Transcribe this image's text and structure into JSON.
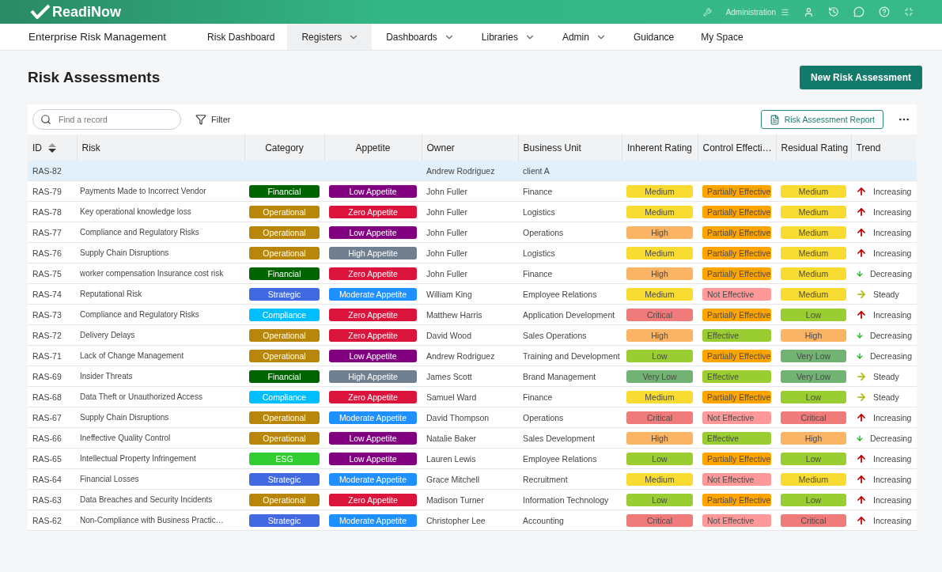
{
  "app": {
    "logo": "ReadiNow",
    "admin_label": "Administration"
  },
  "nav": {
    "title": "Enterprise Risk Management",
    "items": [
      {
        "label": "Risk Dashboard",
        "selected": false,
        "dropdown": false
      },
      {
        "label": "Registers",
        "selected": true,
        "dropdown": true
      },
      {
        "label": "Dashboards",
        "selected": false,
        "dropdown": true
      },
      {
        "label": "Libraries",
        "selected": false,
        "dropdown": true
      },
      {
        "label": "Admin",
        "selected": false,
        "dropdown": true
      },
      {
        "label": "Guidance",
        "selected": false,
        "dropdown": false
      },
      {
        "label": "My Space",
        "selected": false,
        "dropdown": false
      }
    ]
  },
  "page": {
    "title": "Risk Assessments",
    "new_button": "New Risk Assessment"
  },
  "toolbar": {
    "search": {
      "placeholder": "Find a record"
    },
    "filter": "Filter",
    "report_button": "Risk Assessment Report"
  },
  "table": {
    "columns": [
      "ID",
      "Risk",
      "Category",
      "Appetite",
      "Owner",
      "Business Unit",
      "Inherent Rating",
      "Control Effecti…",
      "Residual Rating",
      "Trend"
    ],
    "rows": [
      {
        "id": "RAS-82",
        "risk": "",
        "category": null,
        "appetite": null,
        "owner": "Andrew Rodriguez",
        "unit": "client A",
        "inherent": null,
        "control": null,
        "residual": null,
        "trend": null,
        "selected": true
      },
      {
        "id": "RAS-79",
        "risk": "Payments Made to Incorrect Vendor",
        "category": {
          "label": "Financial",
          "color": "#006400"
        },
        "appetite": {
          "label": "Low Appetite",
          "color": "#800080"
        },
        "owner": "John Fuller",
        "unit": "Finance",
        "inherent": {
          "label": "Medium",
          "color": "#f9dc32"
        },
        "control": {
          "label": "Partially Effective",
          "color": "#ffa500"
        },
        "residual": {
          "label": "Medium",
          "color": "#f9dc32"
        },
        "trend": {
          "label": "Increasing",
          "kind": "up"
        },
        "selected": false
      },
      {
        "id": "RAS-78",
        "risk": "Key operational knowledge loss",
        "category": {
          "label": "Operational",
          "color": "#b8860b"
        },
        "appetite": {
          "label": "Zero Appetite",
          "color": "#dc143c"
        },
        "owner": "John Fuller",
        "unit": "Logistics",
        "inherent": {
          "label": "Medium",
          "color": "#f9dc32"
        },
        "control": {
          "label": "Partially Effective",
          "color": "#ffa500"
        },
        "residual": {
          "label": "Medium",
          "color": "#f9dc32"
        },
        "trend": {
          "label": "Increasing",
          "kind": "up"
        },
        "selected": false
      },
      {
        "id": "RAS-77",
        "risk": "Compliance and Regulatory Risks",
        "category": {
          "label": "Operational",
          "color": "#b8860b"
        },
        "appetite": {
          "label": "Low Appetite",
          "color": "#800080"
        },
        "owner": "John Fuller",
        "unit": "Operations",
        "inherent": {
          "label": "High",
          "color": "#fbb464"
        },
        "control": {
          "label": "Partially Effective",
          "color": "#ffa500"
        },
        "residual": {
          "label": "Medium",
          "color": "#f9dc32"
        },
        "trend": {
          "label": "Increasing",
          "kind": "up"
        },
        "selected": false
      },
      {
        "id": "RAS-76",
        "risk": "Supply Chain Disruptions",
        "category": {
          "label": "Operational",
          "color": "#b8860b"
        },
        "appetite": {
          "label": "High Appetite",
          "color": "#708090"
        },
        "owner": "John Fuller",
        "unit": "Logistics",
        "inherent": {
          "label": "Medium",
          "color": "#f9dc32"
        },
        "control": {
          "label": "Partially Effective",
          "color": "#ffa500"
        },
        "residual": {
          "label": "Medium",
          "color": "#f9dc32"
        },
        "trend": {
          "label": "Increasing",
          "kind": "up"
        },
        "selected": false
      },
      {
        "id": "RAS-75",
        "risk": "worker compensation Insurance cost risk",
        "category": {
          "label": "Financial",
          "color": "#006400"
        },
        "appetite": {
          "label": "Zero Appetite",
          "color": "#dc143c"
        },
        "owner": "John Fuller",
        "unit": "Finance",
        "inherent": {
          "label": "High",
          "color": "#fbb464"
        },
        "control": {
          "label": "Partially Effective",
          "color": "#ffa500"
        },
        "residual": {
          "label": "Medium",
          "color": "#f9dc32"
        },
        "trend": {
          "label": "Decreasing",
          "kind": "down"
        },
        "selected": false
      },
      {
        "id": "RAS-74",
        "risk": "Reputational Risk",
        "category": {
          "label": "Strategic",
          "color": "#4169e1"
        },
        "appetite": {
          "label": "Moderate Appetite",
          "color": "#1e90ff"
        },
        "owner": "William King",
        "unit": "Employee Relations",
        "inherent": {
          "label": "Medium",
          "color": "#f9dc32"
        },
        "control": {
          "label": "Not Effective",
          "color": "#ff9999"
        },
        "residual": {
          "label": "Medium",
          "color": "#f9dc32"
        },
        "trend": {
          "label": "Steady",
          "kind": "steady"
        },
        "selected": false
      },
      {
        "id": "RAS-73",
        "risk": "Compliance and Regulatory Risks",
        "category": {
          "label": "Compliance",
          "color": "#00bfff"
        },
        "appetite": {
          "label": "Zero Appetite",
          "color": "#dc143c"
        },
        "owner": "Matthew Harris",
        "unit": "Application Development",
        "inherent": {
          "label": "Critical",
          "color": "#ef7b7b"
        },
        "control": {
          "label": "Partially Effective",
          "color": "#ffa500"
        },
        "residual": {
          "label": "Low",
          "color": "#9acd32"
        },
        "trend": {
          "label": "Increasing",
          "kind": "up"
        },
        "selected": false
      },
      {
        "id": "RAS-72",
        "risk": "Delivery Delays",
        "category": {
          "label": "Operational",
          "color": "#b8860b"
        },
        "appetite": {
          "label": "Zero Appetite",
          "color": "#dc143c"
        },
        "owner": "David Wood",
        "unit": "Sales Operations",
        "inherent": {
          "label": "High",
          "color": "#fbb464"
        },
        "control": {
          "label": "Effective",
          "color": "#9acd32"
        },
        "residual": {
          "label": "High",
          "color": "#fbb464"
        },
        "trend": {
          "label": "Decreasing",
          "kind": "down"
        },
        "selected": false
      },
      {
        "id": "RAS-71",
        "risk": "Lack of Change Management",
        "category": {
          "label": "Operational",
          "color": "#b8860b"
        },
        "appetite": {
          "label": "Low Appetite",
          "color": "#800080"
        },
        "owner": "Andrew Rodriguez",
        "unit": "Training and Development",
        "inherent": {
          "label": "Low",
          "color": "#9acd32"
        },
        "control": {
          "label": "Partially Effective",
          "color": "#ffa500"
        },
        "residual": {
          "label": "Very Low",
          "color": "#72b272"
        },
        "trend": {
          "label": "Decreasing",
          "kind": "down"
        },
        "selected": false
      },
      {
        "id": "RAS-69",
        "risk": "Insider Threats",
        "category": {
          "label": "Financial",
          "color": "#006400"
        },
        "appetite": {
          "label": "High Appetite",
          "color": "#708090"
        },
        "owner": "James Scott",
        "unit": "Brand Management",
        "inherent": {
          "label": "Very Low",
          "color": "#72b272"
        },
        "control": {
          "label": "Effective",
          "color": "#9acd32"
        },
        "residual": {
          "label": "Very Low",
          "color": "#72b272"
        },
        "trend": {
          "label": "Steady",
          "kind": "steady"
        },
        "selected": false
      },
      {
        "id": "RAS-68",
        "risk": "Data Theft or Unauthorized Access",
        "category": {
          "label": "Compliance",
          "color": "#00bfff"
        },
        "appetite": {
          "label": "Zero Appetite",
          "color": "#dc143c"
        },
        "owner": "Samuel Ward",
        "unit": "Finance",
        "inherent": {
          "label": "Medium",
          "color": "#f9dc32"
        },
        "control": {
          "label": "Partially Effective",
          "color": "#ffa500"
        },
        "residual": {
          "label": "Low",
          "color": "#9acd32"
        },
        "trend": {
          "label": "Steady",
          "kind": "steady"
        },
        "selected": false
      },
      {
        "id": "RAS-67",
        "risk": "Supply Chain Disruptions",
        "category": {
          "label": "Operational",
          "color": "#b8860b"
        },
        "appetite": {
          "label": "Moderate Appetite",
          "color": "#1e90ff"
        },
        "owner": "David Thompson",
        "unit": "Operations",
        "inherent": {
          "label": "Critical",
          "color": "#ef7b7b"
        },
        "control": {
          "label": "Not Effective",
          "color": "#ff9999"
        },
        "residual": {
          "label": "Critical",
          "color": "#ef7b7b"
        },
        "trend": {
          "label": "Increasing",
          "kind": "up"
        },
        "selected": false
      },
      {
        "id": "RAS-66",
        "risk": "Ineffective Quality Control",
        "category": {
          "label": "Operational",
          "color": "#b8860b"
        },
        "appetite": {
          "label": "Low Appetite",
          "color": "#800080"
        },
        "owner": "Natalie Baker",
        "unit": "Sales Development",
        "inherent": {
          "label": "High",
          "color": "#fbb464"
        },
        "control": {
          "label": "Effective",
          "color": "#9acd32"
        },
        "residual": {
          "label": "High",
          "color": "#fbb464"
        },
        "trend": {
          "label": "Decreasing",
          "kind": "down"
        },
        "selected": false
      },
      {
        "id": "RAS-65",
        "risk": "Intellectual Property Infringement",
        "category": {
          "label": "ESG",
          "color": "#32cd32"
        },
        "appetite": {
          "label": "Low Appetite",
          "color": "#800080"
        },
        "owner": "Lauren Lewis",
        "unit": "Employee Relations",
        "inherent": {
          "label": "Low",
          "color": "#9acd32"
        },
        "control": {
          "label": "Partially Effective",
          "color": "#ffa500"
        },
        "residual": {
          "label": "Low",
          "color": "#9acd32"
        },
        "trend": {
          "label": "Increasing",
          "kind": "up"
        },
        "selected": false
      },
      {
        "id": "RAS-64",
        "risk": "Financial Losses",
        "category": {
          "label": "Strategic",
          "color": "#4169e1"
        },
        "appetite": {
          "label": "Moderate Appetite",
          "color": "#1e90ff"
        },
        "owner": "Grace Mitchell",
        "unit": "Recruitment",
        "inherent": {
          "label": "Medium",
          "color": "#f9dc32"
        },
        "control": {
          "label": "Not Effective",
          "color": "#ff9999"
        },
        "residual": {
          "label": "Medium",
          "color": "#f9dc32"
        },
        "trend": {
          "label": "Increasing",
          "kind": "up"
        },
        "selected": false
      },
      {
        "id": "RAS-63",
        "risk": "Data Breaches and Security Incidents",
        "category": {
          "label": "Operational",
          "color": "#b8860b"
        },
        "appetite": {
          "label": "Zero Appetite",
          "color": "#dc143c"
        },
        "owner": "Madison Turner",
        "unit": "Information Technology",
        "inherent": {
          "label": "Low",
          "color": "#9acd32"
        },
        "control": {
          "label": "Partially Effective",
          "color": "#ffa500"
        },
        "residual": {
          "label": "Low",
          "color": "#9acd32"
        },
        "trend": {
          "label": "Increasing",
          "kind": "up"
        },
        "selected": false
      },
      {
        "id": "RAS-62",
        "risk": "Non-Compliance with Business Practic…",
        "category": {
          "label": "Strategic",
          "color": "#4169e1"
        },
        "appetite": {
          "label": "Moderate Appetite",
          "color": "#1e90ff"
        },
        "owner": "Christopher Lee",
        "unit": "Accounting",
        "inherent": {
          "label": "Critical",
          "color": "#ef7b7b"
        },
        "control": {
          "label": "Not Effective",
          "color": "#ff9999"
        },
        "residual": {
          "label": "Critical",
          "color": "#ef7b7b"
        },
        "trend": {
          "label": "Increasing",
          "kind": "up"
        },
        "selected": false
      }
    ]
  }
}
